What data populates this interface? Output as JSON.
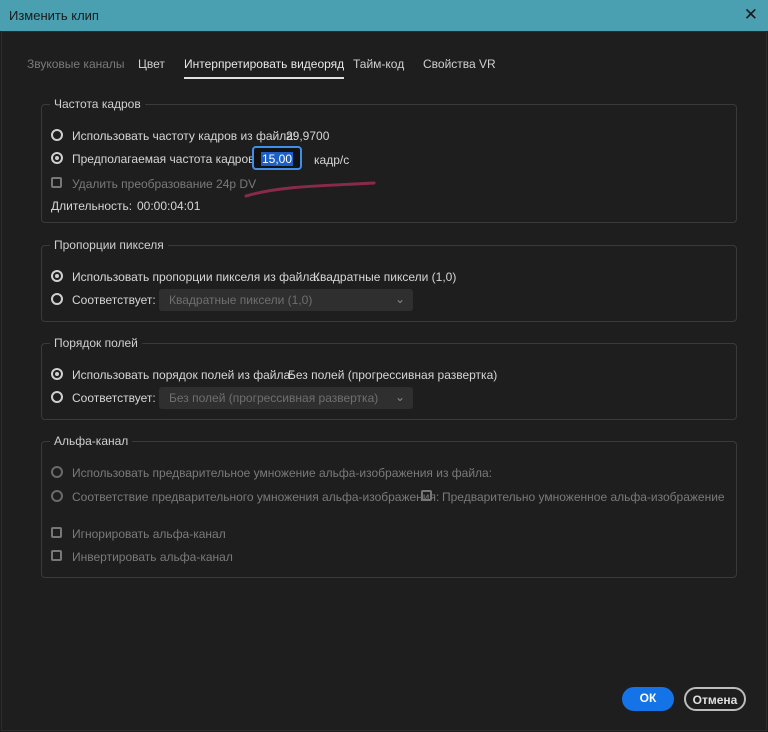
{
  "title": "Изменить клип",
  "tabs": [
    "Звуковые каналы",
    "Цвет",
    "Интерпретировать видеоряд",
    "Тайм-код",
    "Свойства VR"
  ],
  "frame_rate": {
    "legend": "Частота кадров",
    "use_file": "Использовать частоту кадров из файла:",
    "file_value": "29,9700",
    "assume": "Предполагаемая частота кадров:",
    "assume_value": "15,00",
    "unit": "кадр/с",
    "remove_24p": "Удалить преобразование 24p DV",
    "duration_label": "Длительность:",
    "duration_value": "00:00:04:01"
  },
  "pixel": {
    "legend": "Пропорции пикселя",
    "use_file": "Использовать пропорции пикселя из файла:",
    "file_value": "Квадратные пиксели (1,0)",
    "conform": "Соответствует:",
    "conform_value": "Квадратные пиксели (1,0)"
  },
  "fields": {
    "legend": "Порядок полей",
    "use_file": "Использовать порядок полей из файла:",
    "file_value": "Без полей (прогрессивная развертка)",
    "conform": "Соответствует:",
    "conform_value": "Без полей (прогрессивная развертка)"
  },
  "alpha": {
    "legend": "Альфа-канал",
    "use_file": "Использовать предварительное умножение альфа-изображения из файла:",
    "conform": "Соответствие предварительного умножения альфа-изображения:",
    "premultiplied": "Предварительно умноженное альфа-изображение",
    "ignore": "Игнорировать альфа-канал",
    "invert": "Инвертировать альфа-канал"
  },
  "buttons": {
    "ok": "ОК",
    "cancel": "Отмена"
  },
  "colors": {
    "titlebar": "#4a9fb1",
    "accent": "#1473e6",
    "annotation": "#8a2a4a"
  }
}
